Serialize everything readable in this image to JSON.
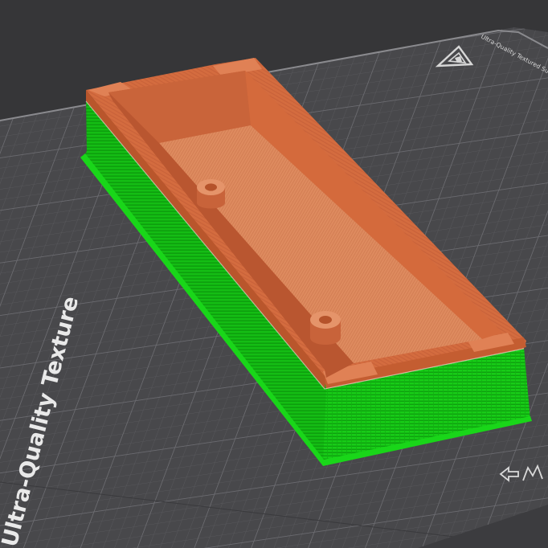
{
  "viewport": {
    "bed": {
      "surface_label": "Ultra-Quality Texture",
      "corner_label": "Ultra-Quality Textured Surface"
    },
    "colors": {
      "background": "#363638",
      "bed_surface": "#4a4a4d",
      "bed_grid_minor": "#5a5a5e",
      "bed_grid_major": "#6e6e73",
      "bed_edge": "#8c8c90",
      "model_wall": "#18d018",
      "model_wall_dark": "#10a010",
      "model_top": "#d46a3c",
      "model_top_light": "#e07e52",
      "model_top_dark": "#b9572e"
    },
    "icons": [
      "bed-logo-icon",
      "axis-marker-icon"
    ]
  }
}
